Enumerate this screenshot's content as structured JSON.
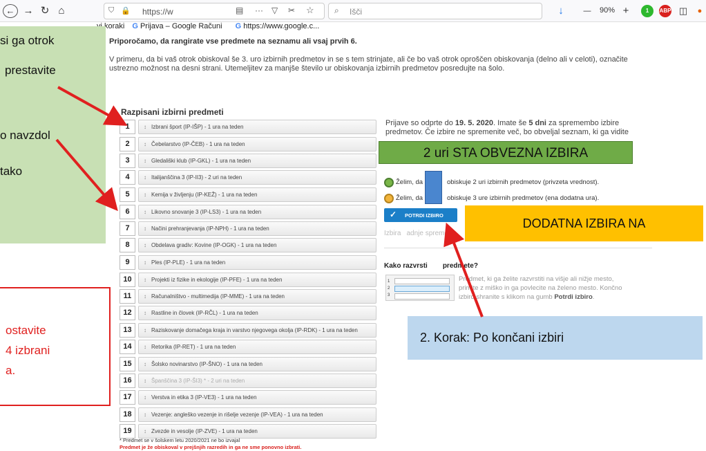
{
  "browser": {
    "back_glyph": "←",
    "forward_glyph": "→",
    "reload_glyph": "↻",
    "home_glyph": "⌂",
    "url_text": "https://w",
    "search_placeholder": "Išči",
    "zoom": "90%",
    "download_glyph": "↓",
    "zoom_minus": "—",
    "zoom_plus": "+",
    "ext_badge_count": "1",
    "abp_label": "ABP"
  },
  "bookmarks": [
    {
      "label": "vi koraki",
      "icon": ""
    },
    {
      "label": "Prijava – Google Računi",
      "icon": "G"
    },
    {
      "label": "https://www.google.c...",
      "icon": "G"
    }
  ],
  "page": {
    "intro_bold": "Priporočamo, da rangirate vse predmete na seznamu ali vsaj prvih 6.",
    "intro_text": "V primeru, da bi vaš otrok obiskoval še 3. uro izbirnih predmetov in se s tem strinjate, ali če bo vaš otrok oproščen obiskovanja (delno ali v celoti), označite ustrezno možnost na desni strani. Utemeljitev za manjše število ur obiskovanja izbirnih predmetov posredujte na šolo.",
    "list_title": "Razpisani izbirni predmeti",
    "subjects": [
      {
        "num": "1",
        "label": "Izbrani šport (IP-IŠP) - 1 ura na teden"
      },
      {
        "num": "2",
        "label": "Čebelarstvo (IP-ČEB) - 1 ura na teden"
      },
      {
        "num": "3",
        "label": "Gledališki klub (IP-GKL) - 1 ura na teden"
      },
      {
        "num": "4",
        "label": "Italijanščina 3 (IP-II3) - 2 uri na teden"
      },
      {
        "num": "5",
        "label": "Kemija v življenju (IP-KEŽ) - 1 ura na teden"
      },
      {
        "num": "6",
        "label": "Likovno snovanje 3 (IP-LS3) - 1 ura na teden"
      },
      {
        "num": "7",
        "label": "Načini prehranjevanja (IP-NPH) - 1 ura na teden"
      },
      {
        "num": "8",
        "label": "Obdelava gradiv: Kovine (IP-OGK) - 1 ura na teden"
      },
      {
        "num": "9",
        "label": "Ples (IP-PLE) - 1 ura na teden"
      },
      {
        "num": "10",
        "label": "Projekti iz fizike in ekologije (IP-PFE) - 1 ura na teden"
      },
      {
        "num": "11",
        "label": "Računalništvo - multimedija (IP-MME) - 1 ura na teden"
      },
      {
        "num": "12",
        "label": "Rastline in človek (IP-RČL) - 1 ura na teden"
      },
      {
        "num": "13",
        "label": "Raziskovanje domačega kraja in varstvo njegovega okolja (IP-RDK) - 1 ura na teden"
      },
      {
        "num": "14",
        "label": "Retorika (IP-RET) - 1 ura na teden"
      },
      {
        "num": "15",
        "label": "Šolsko novinarstvo (IP-ŠNO) - 1 ura na teden"
      },
      {
        "num": "16",
        "label": "Španščina 3 (IP-ŠI3) * - 2 uri na teden"
      },
      {
        "num": "17",
        "label": "Verstva in etika 3 (IP-VE3) - 1 ura na teden"
      },
      {
        "num": "18",
        "label": "Vezenje: angleško vezenje in rišelje vezenje (IP-VEA) - 1 ura na teden"
      },
      {
        "num": "19",
        "label": "Zvezde in vesolje (IP-ZVE) - 1 ura na teden"
      }
    ],
    "footnote_star": "* Predmet se v šolskem letu 2020/2021 ne bo izvajal",
    "footnote_red": "Predmet je že obiskoval v prejšnjih razredih in ga ne sme ponovno izbrati.",
    "info_pre": "Prijave so odprte do ",
    "info_date": "19. 5. 2020",
    "info_mid": ". Imate še ",
    "info_days": "5 dni",
    "info_post": " za spremembo izbire predmetov. Če izbire ne spremenite več, bo obveljal seznam, ki ga vidite",
    "option1_left": "Želim, da",
    "option1_right": "obiskuje 2 uri izbirnih predmetov (privzeta vrednost).",
    "option2_left": "Želim, da",
    "option2_right": "obiskuje 3 ure izbirnih predmetov (ena dodatna ura).",
    "confirm_label": "POTRDI IZBIRO",
    "confirm_check": "✓",
    "status_left": "Izbira",
    "status_right": "adnje spremen",
    "how_title_left": "Kako razvrsti",
    "how_title_right": "predmete?",
    "how_text_line1": "Predmet, ki ga želite razvrstiti na višje ali nižje mesto,",
    "how_text_line2": "primite z miško in ga povlecite na želeno mesto. Končno",
    "how_text_line3_pre": "izbiro shranite s klikom na gumb ",
    "how_text_line3_bold": "Potrdi izbiro",
    "how_text_line3_post": ".",
    "how_nums": [
      "1",
      "2",
      "3"
    ]
  },
  "overlays": {
    "green_box_lines": [
      "si ga otrok",
      "prestavite",
      "o navzdol",
      "tako"
    ],
    "red_box_lines": [
      "ostavite",
      "4 izbrani",
      "a."
    ],
    "green_banner": "2 uri STA OBVEZNA IZBIRA",
    "yellow_banner": "DODATNA IZBIRA NA",
    "blue_callout": "2. Korak: Po končani izbiri"
  },
  "colors": {
    "green_box": "#c8e0b4",
    "green_banner": "#6fab47",
    "yellow_banner": "#ffc000",
    "blue_callout": "#bdd7ee",
    "annotation_red": "#e0201f",
    "button_blue": "#1b7fc8",
    "radio_green": "#7ab648",
    "radio_orange": "#f2b43b"
  }
}
